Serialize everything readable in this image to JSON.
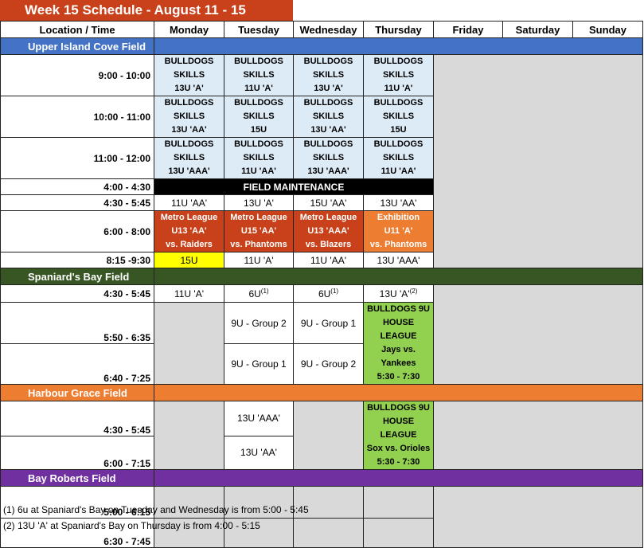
{
  "title": "Week 15 Schedule - August 11 - 15",
  "headers": [
    "Location / Time",
    "Monday",
    "Tuesday",
    "Wednesday",
    "Thursday",
    "Friday",
    "Saturday",
    "Sunday"
  ],
  "sections": {
    "upper": "Upper Island Cove Field",
    "spaniards": "Spaniard's Bay Field",
    "harbour": "Harbour Grace Field",
    "bay": "Bay Roberts Field"
  },
  "upper": {
    "t1": "9:00 - 10:00",
    "t2": "10:00 - 11:00",
    "t3": "11:00 - 12:00",
    "t4": "4:00 - 4:30",
    "t5": "4:30 - 5:45",
    "t6": "6:00 - 8:00",
    "t7": "8:15 -9:30",
    "r1": [
      "BULLDOGS\nSKILLS\n13U 'A'",
      "BULLDOGS\nSKILLS\n11U 'A'",
      "BULLDOGS\nSKILLS\n13U 'A'",
      "BULLDOGS\nSKILLS\n11U 'A'"
    ],
    "r2": [
      "BULLDOGS\nSKILLS\n13U 'AA'",
      "BULLDOGS\nSKILLS\n15U",
      "BULLDOGS\nSKILLS\n13U 'AA'",
      "BULLDOGS\nSKILLS\n15U"
    ],
    "r3": [
      "BULLDOGS\nSKILLS\n13U 'AAA'",
      "BULLDOGS\nSKILLS\n11U 'AA'",
      "BULLDOGS\nSKILLS\n13U 'AAA'",
      "BULLDOGS\nSKILLS\n11U 'AA'"
    ],
    "maintenance": "FIELD MAINTENANCE",
    "r5": [
      "11U 'AA'",
      "13U 'A'",
      "15U 'AA'",
      "13U 'AA'"
    ],
    "r6": [
      "Metro League\nU13 'AA'\nvs. Raiders",
      "Metro League\nU15 'AA'\nvs. Phantoms",
      "Metro League\nU13 'AAA'\nvs. Blazers",
      "Exhibition\nU11 'A'\nvs. Phantoms"
    ],
    "r7": [
      "15U",
      "11U 'A'",
      "11U 'AA'",
      "13U 'AAA'"
    ]
  },
  "spaniards": {
    "t1": "4:30 - 5:45",
    "t2": "5:50 - 6:35",
    "t3": "6:40 - 7:25",
    "r1_mon": "11U 'A'",
    "r1_tue": "6U",
    "r1_tue_sup": "(1)",
    "r1_wed": "6U",
    "r1_wed_sup": "(1)",
    "r1_thu": "13U 'A'",
    "r1_thu_sup": "(2)",
    "r2_tue": "9U - Group 2",
    "r2_wed": "9U - Group 1",
    "r3_tue": "9U - Group 1",
    "r3_wed": "9U - Group 2",
    "thu_block": "BULLDOGS 9U\nHOUSE LEAGUE\nJays vs. Yankees\n5:30 - 7:30"
  },
  "harbour": {
    "t1": "4:30 - 5:45",
    "t2": "6:00 - 7:15",
    "r1_tue": "13U 'AAA'",
    "r2_tue": "13U 'AA'",
    "thu_block": "BULLDOGS 9U\nHOUSE LEAGUE\nSox vs. Orioles\n5:30 - 7:30"
  },
  "bay": {
    "t1": "5:00 - 6:15",
    "t2": "6:30 - 7:45"
  },
  "notes": [
    "(1) 6u at Spaniard's Bay on Tuesday and Wednesday is from 5:00 - 5:45",
    "(2) 13U 'A' at Spaniard's Bay on Thursday is from 4:00 - 5:15"
  ],
  "colors": {
    "title_bg": "#c8411b",
    "section_blue": "#4472c4",
    "section_green": "#375623",
    "section_orange": "#ed7d31",
    "section_purple": "#7030a0",
    "skills_bg": "#ddebf7",
    "metro_bg": "#c8411b",
    "exhibition_bg": "#ed7d31",
    "house_league_bg": "#92d050",
    "highlight_yellow": "#ffff00",
    "empty_gray": "#d9d9d9"
  }
}
